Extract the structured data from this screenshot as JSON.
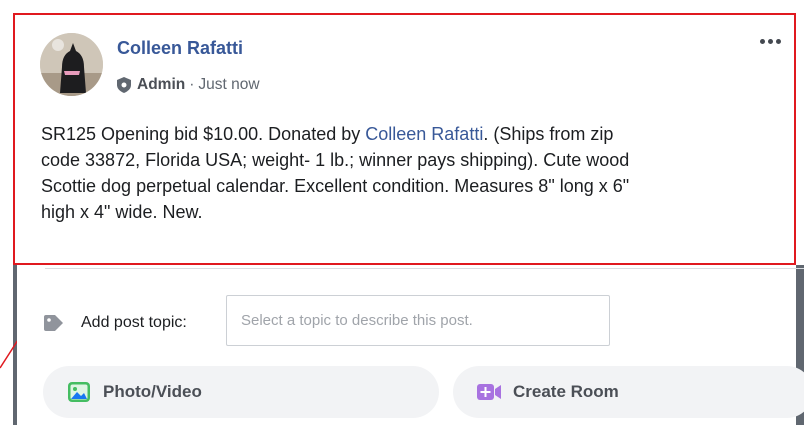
{
  "post": {
    "author": "Colleen Rafatti",
    "role": "Admin",
    "separator": "·",
    "time": "Just now",
    "text": {
      "line1_prefix": "SR125 Opening bid $10.00. Donated by ",
      "line1_link": "Colleen Rafatti",
      "line1_suffix": ". (Ships from zip",
      "line2": "code 33872, Florida USA; weight- 1 lb.; winner pays shipping). Cute wood",
      "line3": "Scottie dog perpetual calendar. Excellent condition. Measures 8\" long x 6\"",
      "line4": "high x 4\" wide. New."
    }
  },
  "composer": {
    "topic_label": "Add post topic:",
    "topic_placeholder": "Select a topic to describe this post.",
    "photo_label": "Photo/Video",
    "room_label": "Create Room"
  },
  "icons": {
    "admin": "shield-icon",
    "more": "more-options-icon",
    "tag": "tag-icon",
    "photo": "photo-icon",
    "room": "video-room-icon"
  },
  "colors": {
    "link": "#385898",
    "highlight_border": "#e0191f",
    "photo_icon": "#45bd62",
    "room_icon": "#a872e0"
  }
}
